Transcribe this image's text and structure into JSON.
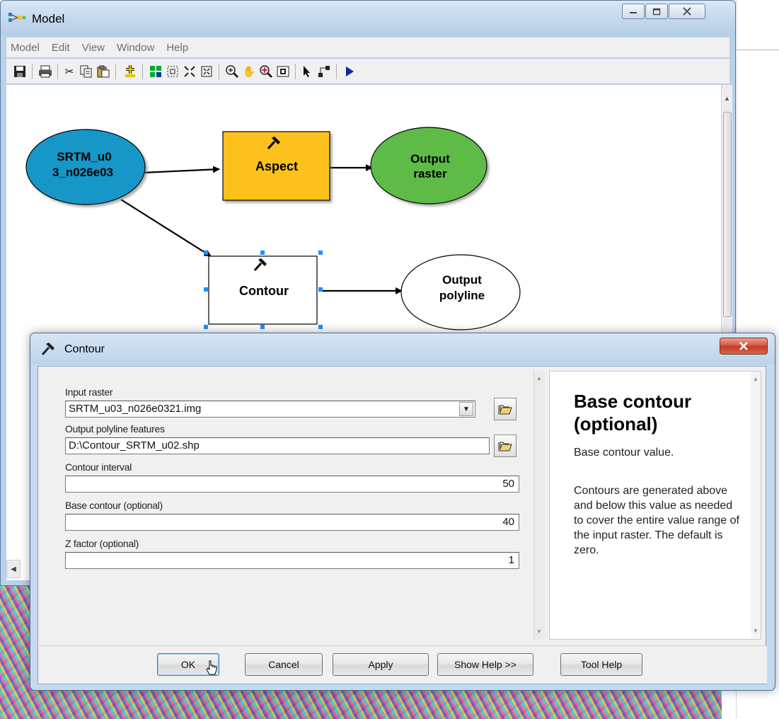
{
  "model_window": {
    "title": "Model",
    "menu": [
      "Model",
      "Edit",
      "View",
      "Window",
      "Help"
    ],
    "toolbar_icons": [
      "save-icon",
      "print-icon",
      "cut-icon",
      "copy-icon",
      "paste-icon",
      "add-data-icon",
      "auto-layout-icon",
      "select-all-icon",
      "full-extent-icon",
      "fit-icon",
      "zoom-in-icon",
      "pan-icon",
      "zoom-tool-icon",
      "overview-icon",
      "select-pointer-icon",
      "connect-icon",
      "run-icon"
    ]
  },
  "diagram": {
    "input_node": [
      "SRTM_u0",
      "3_n026e03"
    ],
    "aspect_tool": "Aspect",
    "aspect_output": [
      "Output",
      "raster"
    ],
    "contour_tool": "Contour",
    "contour_output": [
      "Output",
      "polyline"
    ],
    "colors": {
      "input": "#1297c8",
      "tool": "#fcc11f",
      "output_ready": "#5fbb46",
      "output_pending": "#ffffff"
    }
  },
  "dialog": {
    "title": "Contour",
    "params": {
      "input_raster_label": "Input raster",
      "input_raster_value": "SRTM_u03_n026e0321.img",
      "output_label": "Output polyline features",
      "output_value": "D:\\Contour_SRTM_u02.shp",
      "interval_label": "Contour interval",
      "interval_value": "50",
      "base_label": "Base contour (optional)",
      "base_value": "40",
      "zfactor_label": "Z factor (optional)",
      "zfactor_value": "1"
    },
    "help": {
      "title": "Base contour (optional)",
      "text1": "Base contour value.",
      "text2": "Contours are generated above and below this value as needed to cover the entire value range of the input raster. The default is zero."
    },
    "buttons": {
      "ok": "OK",
      "cancel": "Cancel",
      "apply": "Apply",
      "show_help": "Show Help >>",
      "tool_help": "Tool Help"
    }
  }
}
